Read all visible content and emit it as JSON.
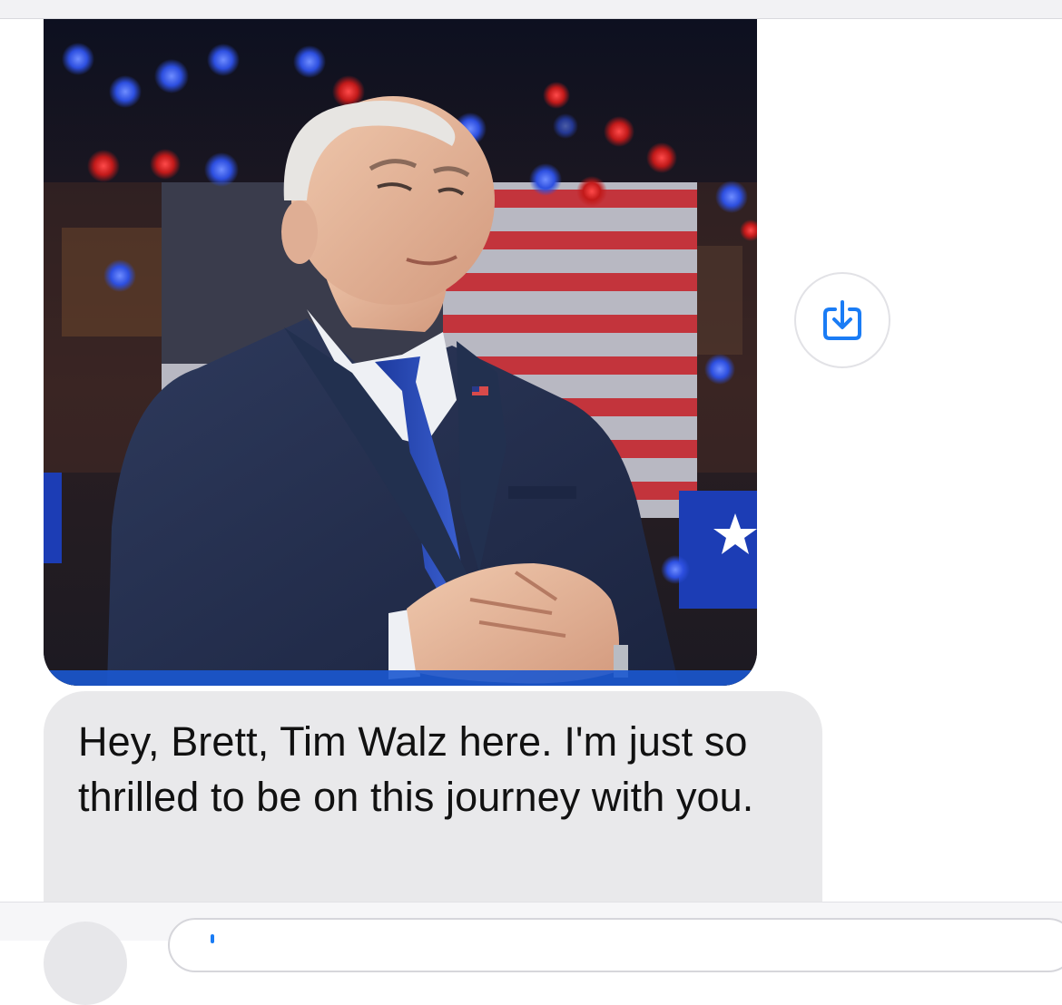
{
  "conversation": {
    "messages": [
      {
        "kind": "image",
        "save_icon": "download-icon",
        "save_icon_color": "#1a7cf5"
      },
      {
        "kind": "text",
        "text": "Hey, Brett, Tim Walz here. I'm just so thrilled to be on this journey with you."
      }
    ]
  },
  "composer": {
    "caret_color": "#1a7cf5"
  }
}
